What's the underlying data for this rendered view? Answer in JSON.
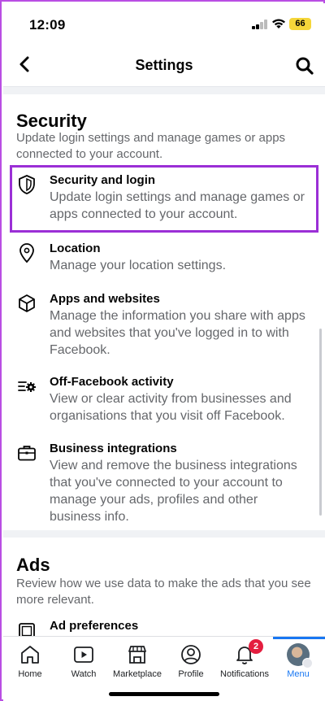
{
  "status_bar": {
    "time": "12:09",
    "battery": "66"
  },
  "header": {
    "title": "Settings"
  },
  "security": {
    "title": "Security",
    "description": "Update login settings and manage games or apps connected to your account.",
    "items": [
      {
        "label": "Security and login",
        "description": "Update login settings and manage games or apps connected to your account.",
        "icon": "shield-icon"
      },
      {
        "label": "Location",
        "description": "Manage your location settings.",
        "icon": "location-pin-icon"
      },
      {
        "label": "Apps and websites",
        "description": "Manage the information you share with apps and websites that you've logged in to with Facebook.",
        "icon": "cube-icon"
      },
      {
        "label": "Off-Facebook activity",
        "description": "View or clear activity from businesses and organisations that you visit off Facebook.",
        "icon": "activity-gear-icon"
      },
      {
        "label": "Business integrations",
        "description": "View and remove the business integrations that you've connected to your account to manage your ads, profiles and other business info.",
        "icon": "briefcase-icon"
      }
    ]
  },
  "ads": {
    "title": "Ads",
    "description": "Review how we use data to make the ads that you see more relevant.",
    "items": [
      {
        "label": "Ad preferences",
        "icon": "ad-preferences-icon"
      }
    ]
  },
  "tabbar": {
    "tabs": [
      {
        "label": "Home",
        "icon": "home-icon"
      },
      {
        "label": "Watch",
        "icon": "video-icon"
      },
      {
        "label": "Marketplace",
        "icon": "shop-icon"
      },
      {
        "label": "Profile",
        "icon": "profile-icon"
      },
      {
        "label": "Notifications",
        "icon": "bell-icon",
        "badge": "2"
      },
      {
        "label": "Menu",
        "icon": "avatar-icon"
      }
    ],
    "active": "Menu"
  },
  "colors": {
    "accent": "#1877f2",
    "highlight": "#9b2fd6",
    "badge": "#e41e3f"
  }
}
